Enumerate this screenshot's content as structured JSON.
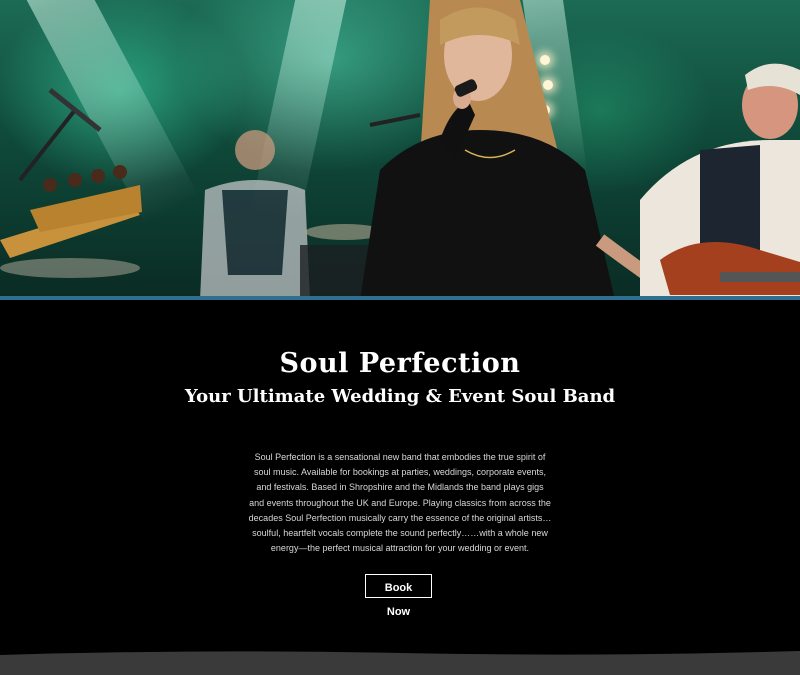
{
  "hero": {
    "image_alt": "Singer with microphone performing on stage with band under green stage lights",
    "colors": {
      "stage_light": "#3cdca8",
      "stage_dark": "#0a2b24"
    }
  },
  "main": {
    "title": "Soul Perfection",
    "subtitle": "Your Ultimate Wedding & Event Soul Band",
    "description": "Soul Perfection is a sensational new band that embodies the true spirit of soul music. Available for bookings at parties, weddings, corporate events, and festivals. Based in Shropshire and the Midlands the band plays gigs and events throughout the UK and Europe. Playing classics from across the decades Soul Perfection musically carry the essence of the original artists…soulful, heartfelt vocals complete the sound perfectly……with a whole new energy—the perfect musical attraction for your wedding or event.",
    "book_button": "Book Now"
  },
  "colors": {
    "background": "#000000",
    "text": "#ffffff",
    "footer_wave": "#3a3a3a"
  }
}
